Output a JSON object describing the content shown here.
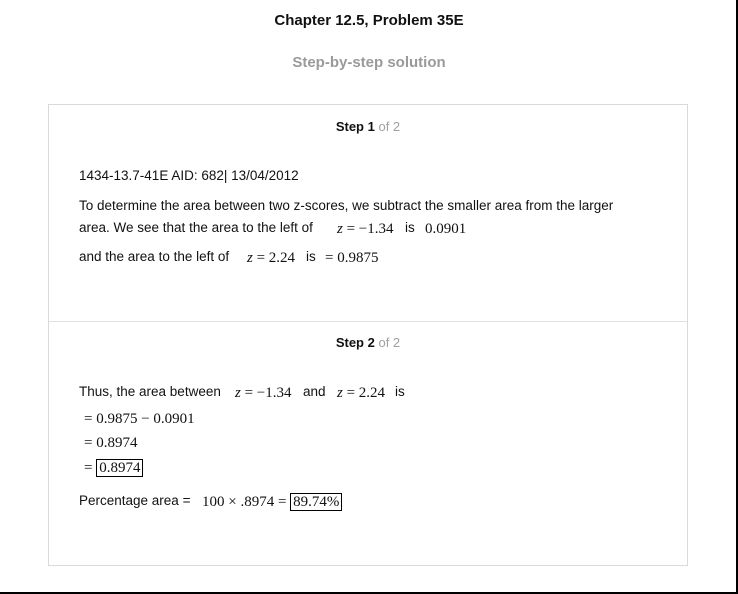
{
  "header": {
    "title": "Chapter 12.5, Problem 35E",
    "subtitle": "Step-by-step solution"
  },
  "step1": {
    "label": "Step 1",
    "of": "of 2",
    "meta": "1434-13.7-41E AID: 682| 13/04/2012",
    "line1": "To determine the area between two z-scores, we subtract the smaller area from the larger",
    "line2_text": "area. We see that the area to the left of",
    "z1_var": "z",
    "z1_eq": "= −1.34",
    "is1": "is",
    "area1": "0.0901",
    "line3_text": "and the area to the left of",
    "z2_var": "z",
    "z2_eq": "= 2.24",
    "is2": "is",
    "area2": "= 0.9875"
  },
  "step2": {
    "label": "Step 2",
    "of": "of 2",
    "lead": "Thus, the area between",
    "za_var": "z",
    "za_eq": "= −1.34",
    "and": "and",
    "zb_var": "z",
    "zb_eq": "= 2.24",
    "is": "is",
    "eq1": "= 0.9875 − 0.0901",
    "eq2": "= 0.8974",
    "eq3_prefix": "=",
    "eq3_boxed": "0.8974",
    "pct_label": "Percentage area =",
    "pct_expr": "100 × .8974 =",
    "pct_boxed": "89.74%"
  }
}
